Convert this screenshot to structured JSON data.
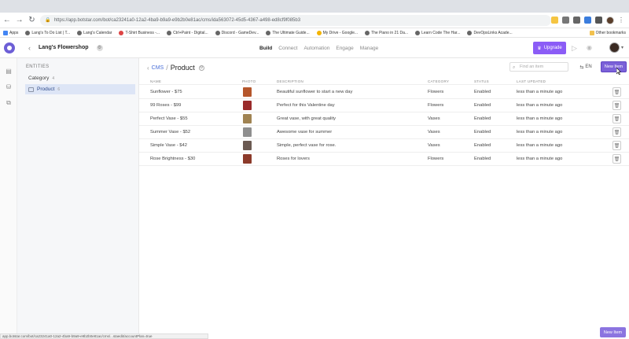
{
  "browser": {
    "url": "https://app.botstar.com/bot/ca23241a0-12a2-4ba9-b9a9-e9b2b0e81ac/cms/ida563072-45d5-4367-a498-ed8cf9f085b3",
    "bookmarks": [
      "Apps",
      "Lang's To Do List | T...",
      "Lang's Calendar",
      "T-Shirt Business -...",
      "Ctrl+Paint - Digital...",
      "Discord - GameDev...",
      "The Ultimate Guide...",
      "My Drive - Google...",
      "The Piano in 21 Da...",
      "Learn Code The Har...",
      "DevOpsLinks Acade..."
    ],
    "other_bookmarks": "Other bookmarks"
  },
  "app": {
    "shop_name": "Lang's Flowershop",
    "tabs": [
      "Build",
      "Connect",
      "Automation",
      "Engage",
      "Manage"
    ],
    "active_tab": "Build",
    "upgrade_label": "Upgrade"
  },
  "entities": {
    "title": "ENTITIES",
    "items": [
      {
        "label": "Category",
        "count": "4"
      },
      {
        "label": "Product",
        "count": "6"
      }
    ]
  },
  "main": {
    "breadcrumb_root": "CMS",
    "breadcrumb_sep": "/",
    "breadcrumb_current": "Product",
    "search_placeholder": "Find an item",
    "lang_label": "EN",
    "new_item_label": "New Item",
    "columns": {
      "name": "NAME",
      "photo": "PHOTO",
      "description": "DESCRIPTION",
      "category": "CATEGORY",
      "status": "STATUS",
      "last_updated": "LAST UPDATED"
    },
    "rows": [
      {
        "name": "Sunflower - $75",
        "description": "Beautiful sunflower to start a new day",
        "category": "Flowers",
        "status": "Enabled",
        "updated": "less than a minute ago",
        "photo_color": "#b5562b"
      },
      {
        "name": "99 Roses - $99",
        "description": "Perfect for this Valentine day",
        "category": "Flowers",
        "status": "Enabled",
        "updated": "less than a minute ago",
        "photo_color": "#9a2b2b"
      },
      {
        "name": "Perfect Vase - $55",
        "description": "Great vase, with great quality",
        "category": "Vases",
        "status": "Enabled",
        "updated": "less than a minute ago",
        "photo_color": "#a08352"
      },
      {
        "name": "Summer Vase - $52",
        "description": "Awesome vase for summer",
        "category": "Vases",
        "status": "Enabled",
        "updated": "less than a minute ago",
        "photo_color": "#8f8f8f"
      },
      {
        "name": "Simple Vase - $42",
        "description": "Simple, perfect vase for rose.",
        "category": "Vases",
        "status": "Enabled",
        "updated": "less than a minute ago",
        "photo_color": "#6b5a52"
      },
      {
        "name": "Rose Brightness - $30",
        "description": "Roses for lovers",
        "category": "Flowers",
        "status": "Enabled",
        "updated": "less than a minute ago",
        "photo_color": "#8c3a2a"
      }
    ]
  },
  "status_bar": "app.botstar.com/bot/ca23241a0-12a2-4ba9-b9a9-e9b2b0e81ac/cms/...staedit/accountPlan=true",
  "footer": {
    "new_item_label": "New Item"
  },
  "colors": {
    "accent": "#7b61d8",
    "link": "#4a6fd8",
    "selected_bg": "#dde5f6"
  }
}
